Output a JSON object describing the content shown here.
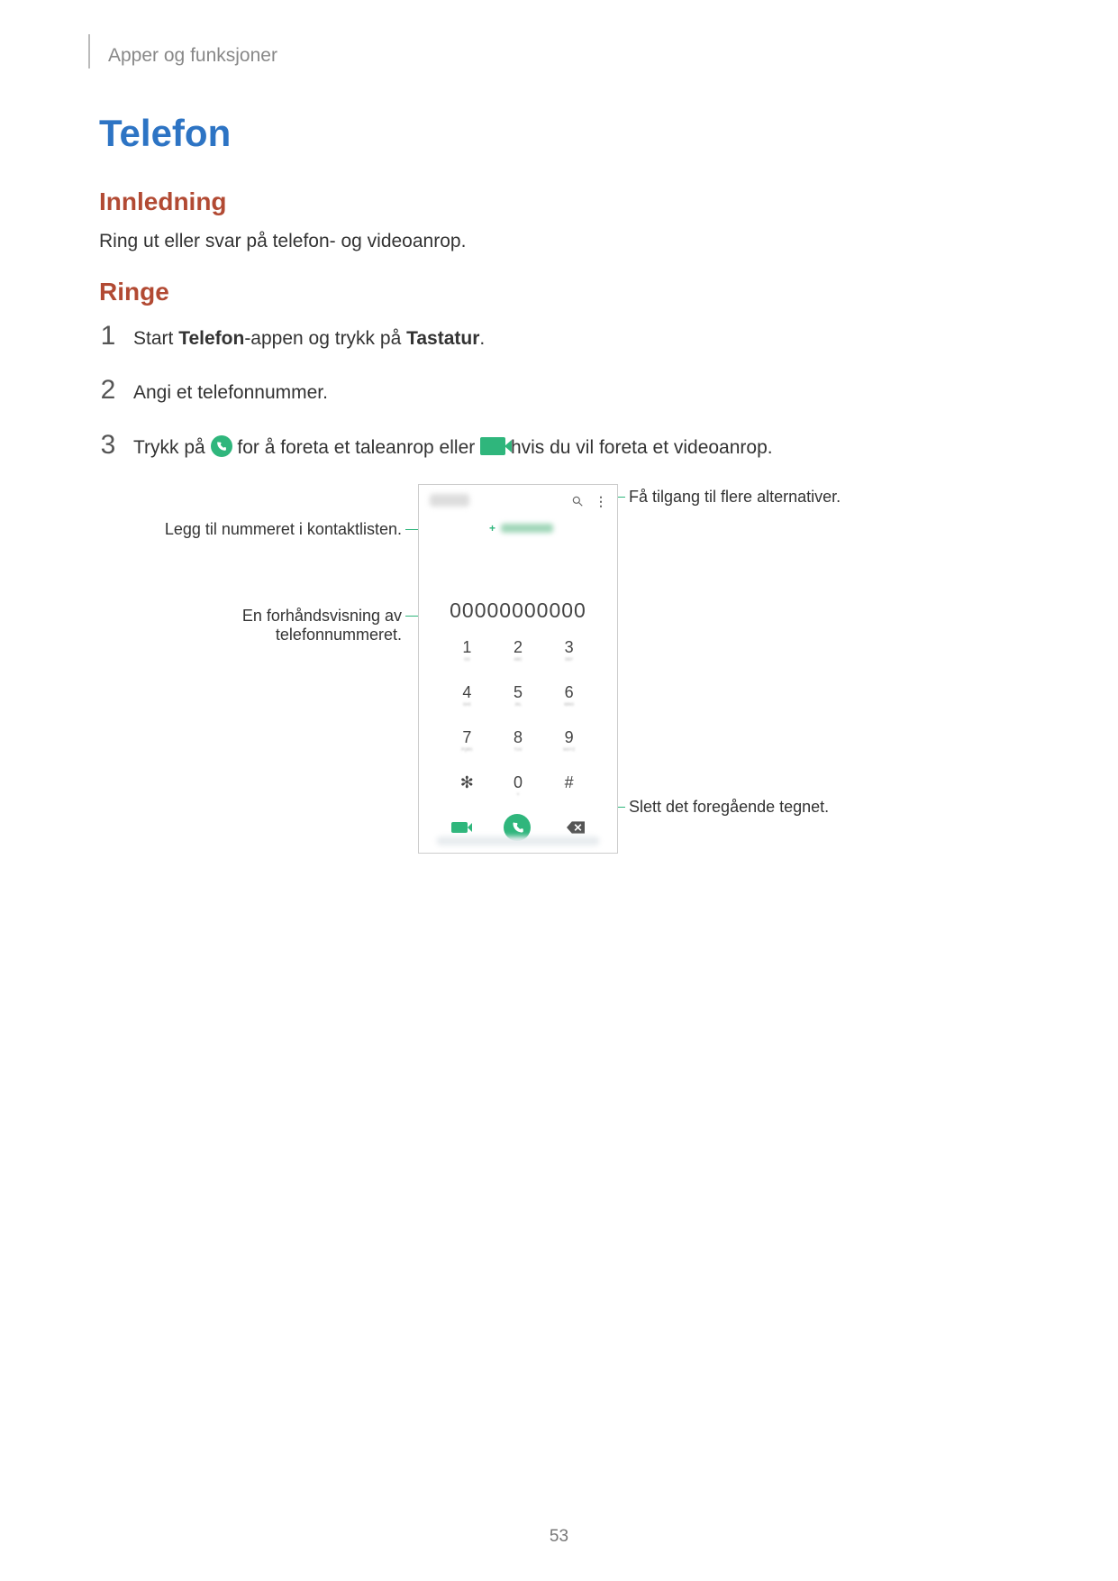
{
  "breadcrumb": "Apper og funksjoner",
  "title": "Telefon",
  "section_intro": "Innledning",
  "intro_text": "Ring ut eller svar på telefon- og videoanrop.",
  "section_call": "Ringe",
  "steps": [
    {
      "pre": "Start ",
      "b1": "Telefon",
      "mid": "-appen og trykk på ",
      "b2": "Tastatur",
      "post": "."
    },
    {
      "text": "Angi et telefonnummer."
    },
    {
      "pre": "Trykk på ",
      "mid": " for å foreta et taleanrop eller ",
      "post": " hvis du vil foreta et videoanrop."
    }
  ],
  "callouts": {
    "more": "Få tilgang til flere alternativer.",
    "add_contact": "Legg til nummeret i kontaktlisten.",
    "preview_l1": "En forhåndsvisning av",
    "preview_l2": "telefonnummeret.",
    "delete": "Slett det foregående tegnet."
  },
  "phone": {
    "number": "00000000000",
    "keys": [
      "1",
      "2",
      "3",
      "4",
      "5",
      "6",
      "7",
      "8",
      "9",
      "✻",
      "0",
      "#"
    ],
    "zero_sub": "+"
  },
  "page_number": "53"
}
